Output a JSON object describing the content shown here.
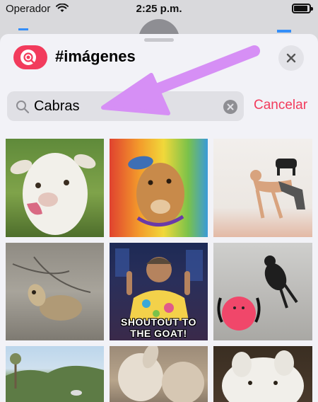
{
  "status_bar": {
    "carrier": "Operador",
    "time": "2:25 p.m."
  },
  "sheet": {
    "title": "#imágenes",
    "app_icon": "images-search-icon",
    "close_icon": "close-icon"
  },
  "search": {
    "value": "Cabras",
    "clear_icon": "clear-icon",
    "cancel_label": "Cancelar"
  },
  "gifs": [
    {
      "name": "goat-tongue"
    },
    {
      "name": "goat-rainbow"
    },
    {
      "name": "goat-yoga"
    },
    {
      "name": "goat-lying"
    },
    {
      "name": "goat-shoutout",
      "caption": "SHOUTOUT TO THE GOAT!"
    },
    {
      "name": "goat-ball"
    },
    {
      "name": "goat-landscape"
    },
    {
      "name": "goat-closeup"
    },
    {
      "name": "llama-closeup"
    }
  ],
  "colors": {
    "accent": "#f23b5c",
    "arrow": "#d68ff5"
  }
}
